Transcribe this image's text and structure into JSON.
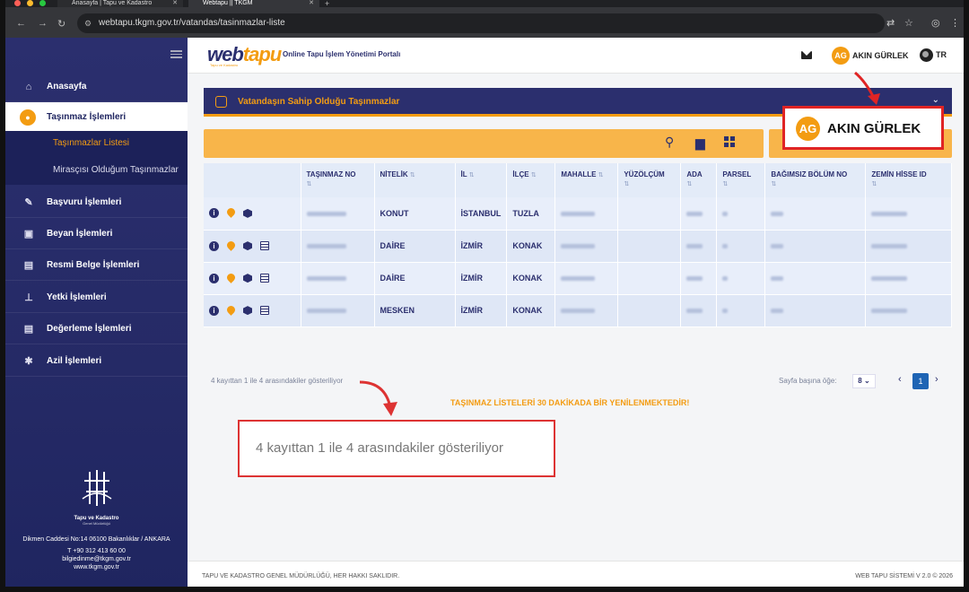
{
  "browser": {
    "tabs": [
      {
        "title": "Anasayfa | Tapu ve Kadastro"
      },
      {
        "title": "Webtapu || TKGM"
      }
    ],
    "url": "webtapu.tkgm.gov.tr/vatandas/tasinmazlar-liste"
  },
  "sidebar": {
    "items": [
      {
        "label": "Anasayfa",
        "icon": "home-icon"
      },
      {
        "label": "Taşınmaz İşlemleri",
        "icon": "property-icon"
      },
      {
        "label": "Başvuru İşlemleri",
        "icon": "pen-icon"
      },
      {
        "label": "Beyan İşlemleri",
        "icon": "lock-icon"
      },
      {
        "label": "Resmi Belge İşlemleri",
        "icon": "document-icon"
      },
      {
        "label": "Yetki İşlemleri",
        "icon": "stamp-icon"
      },
      {
        "label": "Değerleme İşlemleri",
        "icon": "valuation-icon"
      },
      {
        "label": "Azil İşlemleri",
        "icon": "revoke-icon"
      }
    ],
    "subitems": [
      {
        "label": "Taşınmazlar Listesi",
        "active": true
      },
      {
        "label": "Mirasçısı Olduğum Taşınmazlar"
      }
    ],
    "logo_name": "Tapu ve Kadastro",
    "logo_sub": "Genel Müdürlüğü",
    "address": "Dikmen Caddesi No:14 06100 Bakanlıklar / ANKARA",
    "phone": "T +90 312 413 60 00",
    "email": "bilgiedinme@tkgm.gov.tr",
    "web": "www.tkgm.gov.tr"
  },
  "header": {
    "brand_a": "web",
    "brand_b": "tapu",
    "brand_sub": "Tapu ve Kadastro",
    "portal_title": "Online Tapu İşlem Yönetimi Portalı",
    "user_initials": "AG",
    "user_name": "AKIN GÜRLEK",
    "lang": "TR"
  },
  "panel": {
    "title": "Vatandaşın Sahip Olduğu Taşınmazlar"
  },
  "callout": {
    "initials": "AG",
    "name": "AKIN GÜRLEK"
  },
  "table": {
    "columns": [
      "TAŞINMAZ NO",
      "NİTELİK",
      "İL",
      "İLÇE",
      "MAHALLE",
      "YÜZÖLÇÜM",
      "ADA",
      "PARSEL",
      "BAĞIMSIZ BÖLÜM NO",
      "ZEMİN HİSSE ID"
    ],
    "rows": [
      {
        "nitelik": "KONUT",
        "il": "İSTANBUL",
        "ilce": "TUZLA",
        "has_doc": false
      },
      {
        "nitelik": "DAİRE",
        "il": "İZMİR",
        "ilce": "KONAK",
        "has_doc": true
      },
      {
        "nitelik": "DAİRE",
        "il": "İZMİR",
        "ilce": "KONAK",
        "has_doc": true
      },
      {
        "nitelik": "MESKEN",
        "il": "İZMİR",
        "ilce": "KONAK",
        "has_doc": true
      }
    ]
  },
  "footer_info": {
    "records": "4 kayıttan 1 ile 4 arasındakiler gösteriliyor",
    "notice": "TAŞINMAZ LİSTELERİ 30 DAKİKADA BİR YENİLENMEKTEDİR!",
    "per_page_label": "Sayfa başına öğe:",
    "per_page": "8",
    "current_page": "1"
  },
  "zoom": {
    "text": "4 kayıttan 1 ile 4 arasındakiler gösteriliyor"
  },
  "footer": {
    "left": "TAPU VE KADASTRO GENEL MÜDÜRLÜĞÜ, HER HAKKI SAKLIDIR.",
    "right": "WEB TAPU SİSTEMİ V 2.0 © 2026"
  },
  "colors": {
    "navy": "#2b2f6e",
    "orange": "#f39c12",
    "highlight_red": "#e02424"
  }
}
